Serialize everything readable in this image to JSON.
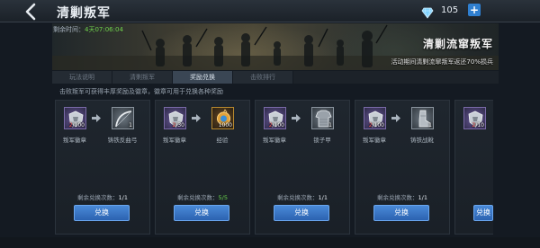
{
  "header": {
    "title": "清剿叛军",
    "currency_value": "105",
    "plus_label": "+"
  },
  "banner": {
    "timer_label": "剩余时间：",
    "timer_value": "4天07:06:04",
    "title": "清剿流窜叛军",
    "description": "活动期间清剿流窜叛军返还70%损兵"
  },
  "tabs": [
    {
      "label": "玩法说明",
      "active": false
    },
    {
      "label": "清剿叛军",
      "active": false
    },
    {
      "label": "奖励兑换",
      "active": true
    },
    {
      "label": "击败排行",
      "active": false
    }
  ],
  "subtitle": "击败叛军可获得丰厚奖励及徽章，徽章可用于兑换各种奖励",
  "cards": [
    {
      "cost": {
        "label": "叛军徽章",
        "count_current": "2",
        "count_required": "/100",
        "icon": "badge-icon"
      },
      "reward": {
        "label": "铸铁反曲弓",
        "count": "1",
        "icon": "bow-icon"
      },
      "remain_label": "剩余兑换次数：",
      "remain_value": "1/1",
      "button_label": "兑换"
    },
    {
      "cost": {
        "label": "叛军徽章",
        "count_current": "2",
        "count_required": "/30",
        "icon": "badge-icon"
      },
      "reward": {
        "label": "经验",
        "count": "1000",
        "icon": "exp-icon"
      },
      "remain_label": "剩余兑换次数：",
      "remain_value": "5/5",
      "button_label": "兑换"
    },
    {
      "cost": {
        "label": "叛军徽章",
        "count_current": "2",
        "count_required": "/100",
        "icon": "badge-icon"
      },
      "reward": {
        "label": "锁子甲",
        "count": "1",
        "icon": "chainmail-icon"
      },
      "remain_label": "剩余兑换次数：",
      "remain_value": "1/1",
      "button_label": "兑换"
    },
    {
      "cost": {
        "label": "叛军徽章",
        "count_current": "2",
        "count_required": "/100",
        "icon": "badge-icon"
      },
      "reward": {
        "label": "铸铁战靴",
        "count": "1",
        "icon": "boots-icon"
      },
      "remain_label": "剩余兑换次数：",
      "remain_value": "1/1",
      "button_label": "兑换"
    }
  ],
  "partial_card": {
    "count_current": "2",
    "count_required": "/10",
    "button_label": "兑换"
  },
  "colors": {
    "accent_blue": "#2f7fd0",
    "count_red": "#ff5a5a",
    "value_green": "#68d44a"
  }
}
